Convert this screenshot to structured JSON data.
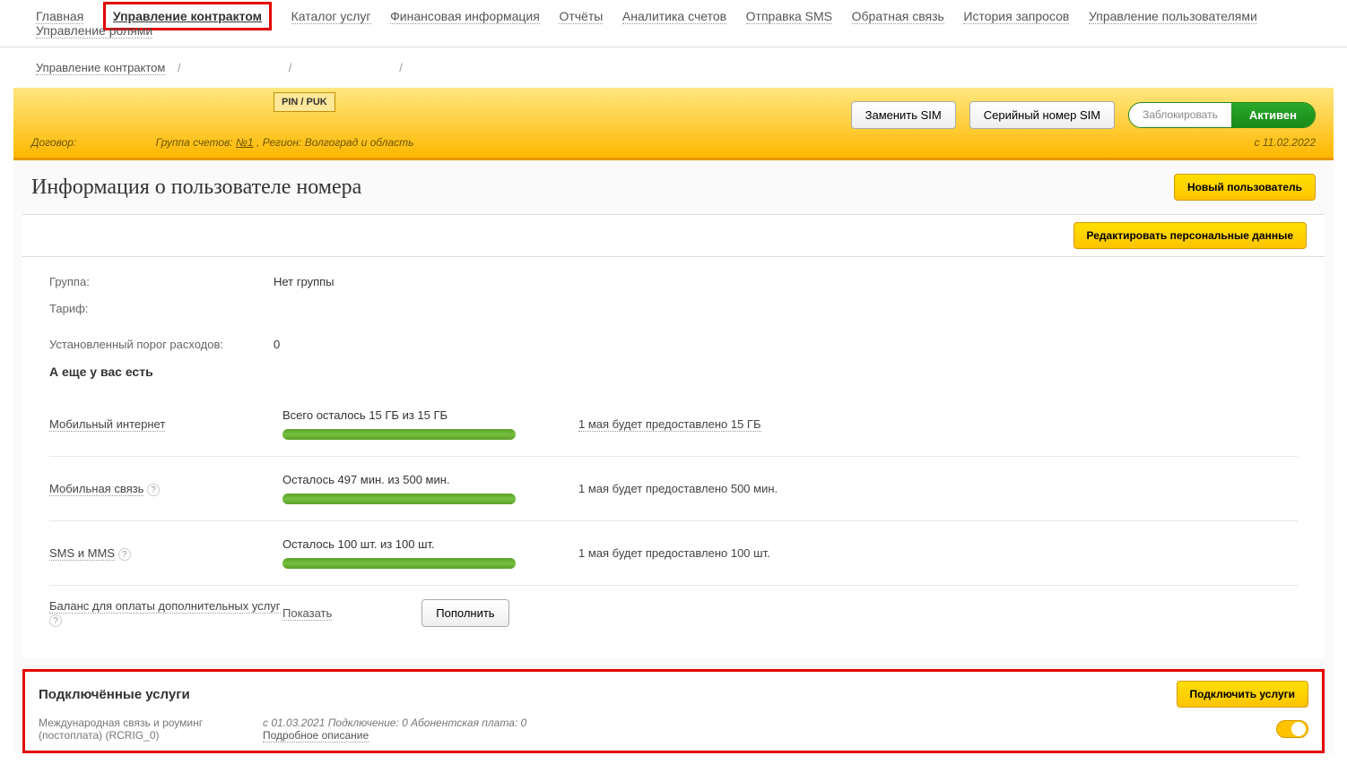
{
  "nav": [
    "Главная",
    "Управление контрактом",
    "Каталог услуг",
    "Финансовая информация",
    "Отчёты",
    "Аналитика счетов",
    "Отправка SMS",
    "Обратная связь",
    "История запросов",
    "Управление пользователями",
    "Управление ролями"
  ],
  "breadcrumb": {
    "root": "Управление контрактом",
    "sep": "/"
  },
  "header": {
    "pin_puk": "PIN / PUK",
    "replace_sim": "Заменить SIM",
    "serial_sim": "Серийный номер SIM",
    "block": "Заблокировать",
    "active": "Активен",
    "contract_label": "Договор:",
    "group_label": "Группа счетов:",
    "group_link": "№1",
    "region_label": ", Регион: Волгоград и область",
    "since": "с 11.02.2022"
  },
  "section": {
    "title": "Информация о пользователе номера",
    "new_user": "Новый пользователь",
    "edit_personal": "Редактировать персональные данные"
  },
  "info": {
    "group_label": "Группа:",
    "group_value": "Нет группы",
    "tariff_label": "Тариф:",
    "threshold_label": "Установленный порог расходов:",
    "threshold_value": "0",
    "also_have": "А еще у вас есть"
  },
  "usage": {
    "internet": {
      "label": "Мобильный интернет",
      "text": "Всего осталось 15 ГБ из 15 ГБ",
      "note": "1 мая будет предоставлено 15 ГБ"
    },
    "voice": {
      "label": "Мобильная связь",
      "text": "Осталось 497 мин. из 500 мин.",
      "note": "1 мая будет предоставлено 500 мин."
    },
    "sms": {
      "label": "SMS и MMS",
      "text": "Осталось 100 шт. из 100 шт.",
      "note": "1 мая будет предоставлено 100 шт."
    }
  },
  "balance": {
    "label": "Баланс для оплаты дополнительных услуг",
    "show": "Показать",
    "topup": "Пополнить"
  },
  "services": {
    "title": "Подключённые услуги",
    "connect_btn": "Подключить услуги",
    "item_name": "Международная связь и роуминг (постоплата) (RCRIG_0)",
    "item_details": "с 01.03.2021 Подключение: 0 Абонентская плата: 0",
    "more_link": "Подробное описание"
  }
}
